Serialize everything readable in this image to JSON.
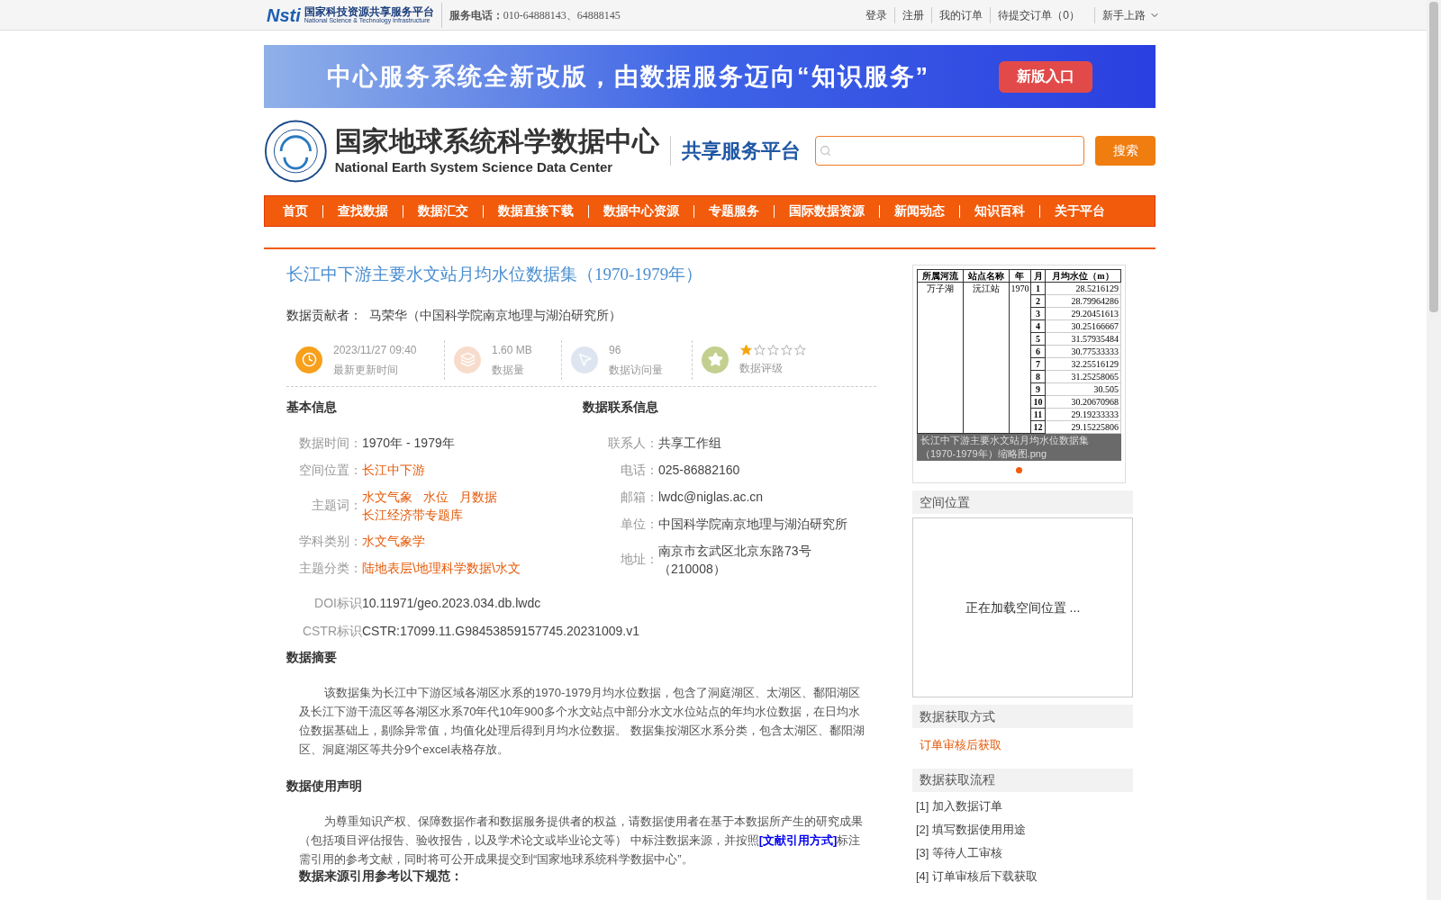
{
  "topbar": {
    "logo_mark": "Nsti",
    "logo_title": "国家科技资源共享服务平台",
    "logo_subtitle": "National Science & Technology Infrastructure",
    "phone_label": "服务电话：",
    "phone": "010-64888143、64888145",
    "links": [
      "登录",
      "注册",
      "我的订单",
      "待提交订单（0）"
    ],
    "guide": "新手上路"
  },
  "banner": {
    "text": "中心服务系统全新改版，由数据服务迈向“知识服务”",
    "button": "新版入口"
  },
  "header": {
    "title_cn": "国家地球系统科学数据中心",
    "title_en": "National Earth System Science Data Center",
    "platform": "共享服务平台",
    "search_button": "搜索"
  },
  "nav": [
    "首页",
    "查找数据",
    "数据汇交",
    "数据直接下载",
    "数据中心资源",
    "专题服务",
    "国际数据资源",
    "新闻动态",
    "知识百科",
    "关于平台"
  ],
  "dataset": {
    "title": "长江中下游主要水文站月均水位数据集（1970-1979年）",
    "contributor_label": "数据贡献者：",
    "contributor": "马荣华（中国科学院南京地理与湖泊研究所）"
  },
  "stats": [
    {
      "kind": "time",
      "value": "2023/11/27 09:40",
      "label": "最新更新时间"
    },
    {
      "kind": "size",
      "value": "1.60 MB",
      "label": "数据量"
    },
    {
      "kind": "visits",
      "value": "96",
      "label": "数据访问量"
    },
    {
      "kind": "rating",
      "stars": 1,
      "label": "数据评级"
    }
  ],
  "basic_info": {
    "heading": "基本信息",
    "rows": [
      {
        "kind": "text",
        "label": "数据时间：",
        "value": "1970年 - 1979年"
      },
      {
        "kind": "links",
        "label": "空间位置：",
        "values": [
          "长江中下游"
        ]
      },
      {
        "kind": "links",
        "label": "主题词：",
        "values": [
          "水文气象",
          "水位",
          "月数据",
          "长江经济带专题库"
        ]
      },
      {
        "kind": "links",
        "label": "学科类别：",
        "values": [
          "水文气象学"
        ]
      },
      {
        "kind": "links",
        "label": "主题分类：",
        "values": [
          "陆地表层\\地理科学数据\\水文"
        ]
      }
    ]
  },
  "contact": {
    "heading": "数据联系信息",
    "rows": [
      {
        "label": "联系人：",
        "value": "共享工作组"
      },
      {
        "label": "电话：",
        "value": "025-86882160"
      },
      {
        "label": "邮箱：",
        "value": "lwdc@niglas.ac.cn"
      },
      {
        "label": "单位：",
        "value": "中国科学院南京地理与湖泊研究所"
      },
      {
        "label": "地址：",
        "value": "南京市玄武区北京东路73号（210008）"
      }
    ]
  },
  "identifiers": [
    {
      "label": "DOI标识",
      "value": "10.11971/geo.2023.034.db.lwdc"
    },
    {
      "label": "CSTR标识",
      "value": "CSTR:17099.11.G98453859157745.20231009.v1"
    }
  ],
  "abstract": {
    "heading": "数据摘要",
    "text": "该数据集为长江中下游区域各湖区水系的1970-1979月均水位数据，包含了洞庭湖区、太湖区、鄱阳湖区及长江下游干流区等各湖区水系70年代10年900多个水文站点中部分水文水位站点的年均水位数据，在日均水位数据基础上，剔除异常值，均值化处理后得到月均水位数据。 数据集按湖区水系分类，包含太湖区、鄱阳湖区、洞庭湖区等共分9个excel表格存放。"
  },
  "usage": {
    "heading": "数据使用声明",
    "text_before": "为尊重知识产权、保障数据作者和数据服务提供者的权益，请数据使用者在基于本数据所产生的研究成果（包括项目评估报告、验收报告，以及学术论文或毕业论文等） 中标注数据来源，并按照",
    "link": "[文献引用方式]",
    "text_after": "标注需引用的参考文献，同时将可公开成果提交到“国家地球系统科学数据中心”。",
    "next_heading": "数据来源引用参考以下规范："
  },
  "thumbnail": {
    "columns": [
      "所属河流",
      "站点名称",
      "年",
      "月",
      "月均水位（m）"
    ],
    "lake": "万子湖",
    "station": "沅江站",
    "year": "1970",
    "rows": [
      [
        "1",
        "28.5216129"
      ],
      [
        "2",
        "28.79964286"
      ],
      [
        "3",
        "29.20451613"
      ],
      [
        "4",
        "30.25166667"
      ],
      [
        "5",
        "31.57935484"
      ],
      [
        "6",
        "30.77533333"
      ],
      [
        "7",
        "32.25516129"
      ],
      [
        "8",
        "31.25258065"
      ],
      [
        "9",
        "30.505"
      ],
      [
        "10",
        "30.20670968"
      ],
      [
        "11",
        "29.19233333"
      ],
      [
        "12",
        "29.15225806"
      ]
    ],
    "caption": "长江中下游主要水文站月均水位数据集（1970-1979年）缩略图.png",
    "dots": [
      {
        "selected": true
      }
    ]
  },
  "spatial": {
    "heading": "空间位置",
    "loading": "正在加载空间位置 ..."
  },
  "access": {
    "heading": "数据获取方式",
    "value": "订单审核后获取"
  },
  "process": {
    "heading": "数据获取流程",
    "steps": [
      "[1] 加入数据订单",
      "[2] 填写数据使用用途",
      "[3] 等待人工审核",
      "[4] 订单审核后下载获取"
    ]
  }
}
